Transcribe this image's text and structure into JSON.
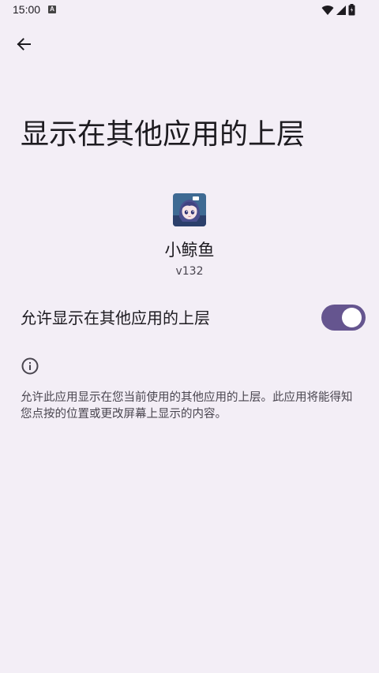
{
  "status_bar": {
    "time": "15:00",
    "notification_icon": "a-letter-icon",
    "wifi_icon": "wifi-icon",
    "signal_icon": "signal-icon",
    "battery_icon": "battery-icon"
  },
  "header": {
    "back_icon": "arrow-back-icon",
    "title": "显示在其他应用的上层"
  },
  "app": {
    "name": "小鲸鱼",
    "version": "v132"
  },
  "permission": {
    "toggle_label": "允许显示在其他应用的上层",
    "enabled": true,
    "switch_color": "#65558f"
  },
  "info": {
    "icon": "info-icon",
    "description": "允许此应用显示在您当前使用的其他应用的上层。此应用将能得知您点按的位置或更改屏幕上显示的内容。"
  },
  "colors": {
    "background": "#f3eef6",
    "accent": "#65558f",
    "text_primary": "#1d1b20",
    "text_secondary": "#49454f"
  }
}
